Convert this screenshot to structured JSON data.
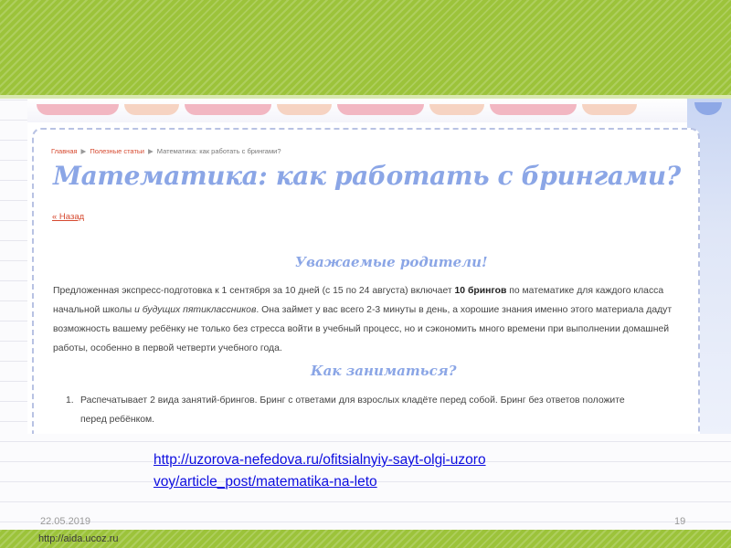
{
  "slide": {
    "date": "22.05.2019",
    "page_number": "19",
    "link_line1": "http://uzorova-nefedova.ru/ofitsialnyiy-sayt-olgi-uzoro",
    "link_line2": "voy/article_post/matematika-na-leto",
    "footer_url": "http://aida.ucoz.ru"
  },
  "screenshot": {
    "breadcrumbs": {
      "home": "Главная",
      "section": "Полезные статьи",
      "current": "Математика: как работать с брингами?"
    },
    "title": "Математика: как работать с брингами?",
    "back_link": "« Назад",
    "greeting_heading": "Уважаемые родители!",
    "para_part1": "Предложенная экспресс-подготовка к 1 сентября за 10 дней (с 15 по 24 августа) включает ",
    "para_bold": "10 брингов",
    "para_part2": " по математике для каждого класса начальной школы ",
    "para_italic": "и будущих пятиклассников",
    "para_part3": ". Она займет у вас всего 2-3 минуты в день, а хорошие знания именно этого материала дадут возможность вашему ребёнку не только без стресса войти в учебный процесс, но и сэкономить много времени при выполнении домашней работы, особенно в первой четверти учебного года.",
    "how_heading": "Как заниматься?",
    "list_item1_num": "1.",
    "list_item1_line1": "Распечатывает 2 вида занятий-брингов. Бринг с ответами для взрослых кладёте перед собой. Бринг без ответов положите",
    "list_item1_line2": "перед ребёнком."
  },
  "colors": {
    "band_green": "#9cc33a",
    "title_blue": "#8ba6e6",
    "link_red": "#d6492f",
    "hyperlink_blue": "#0d0de0"
  }
}
